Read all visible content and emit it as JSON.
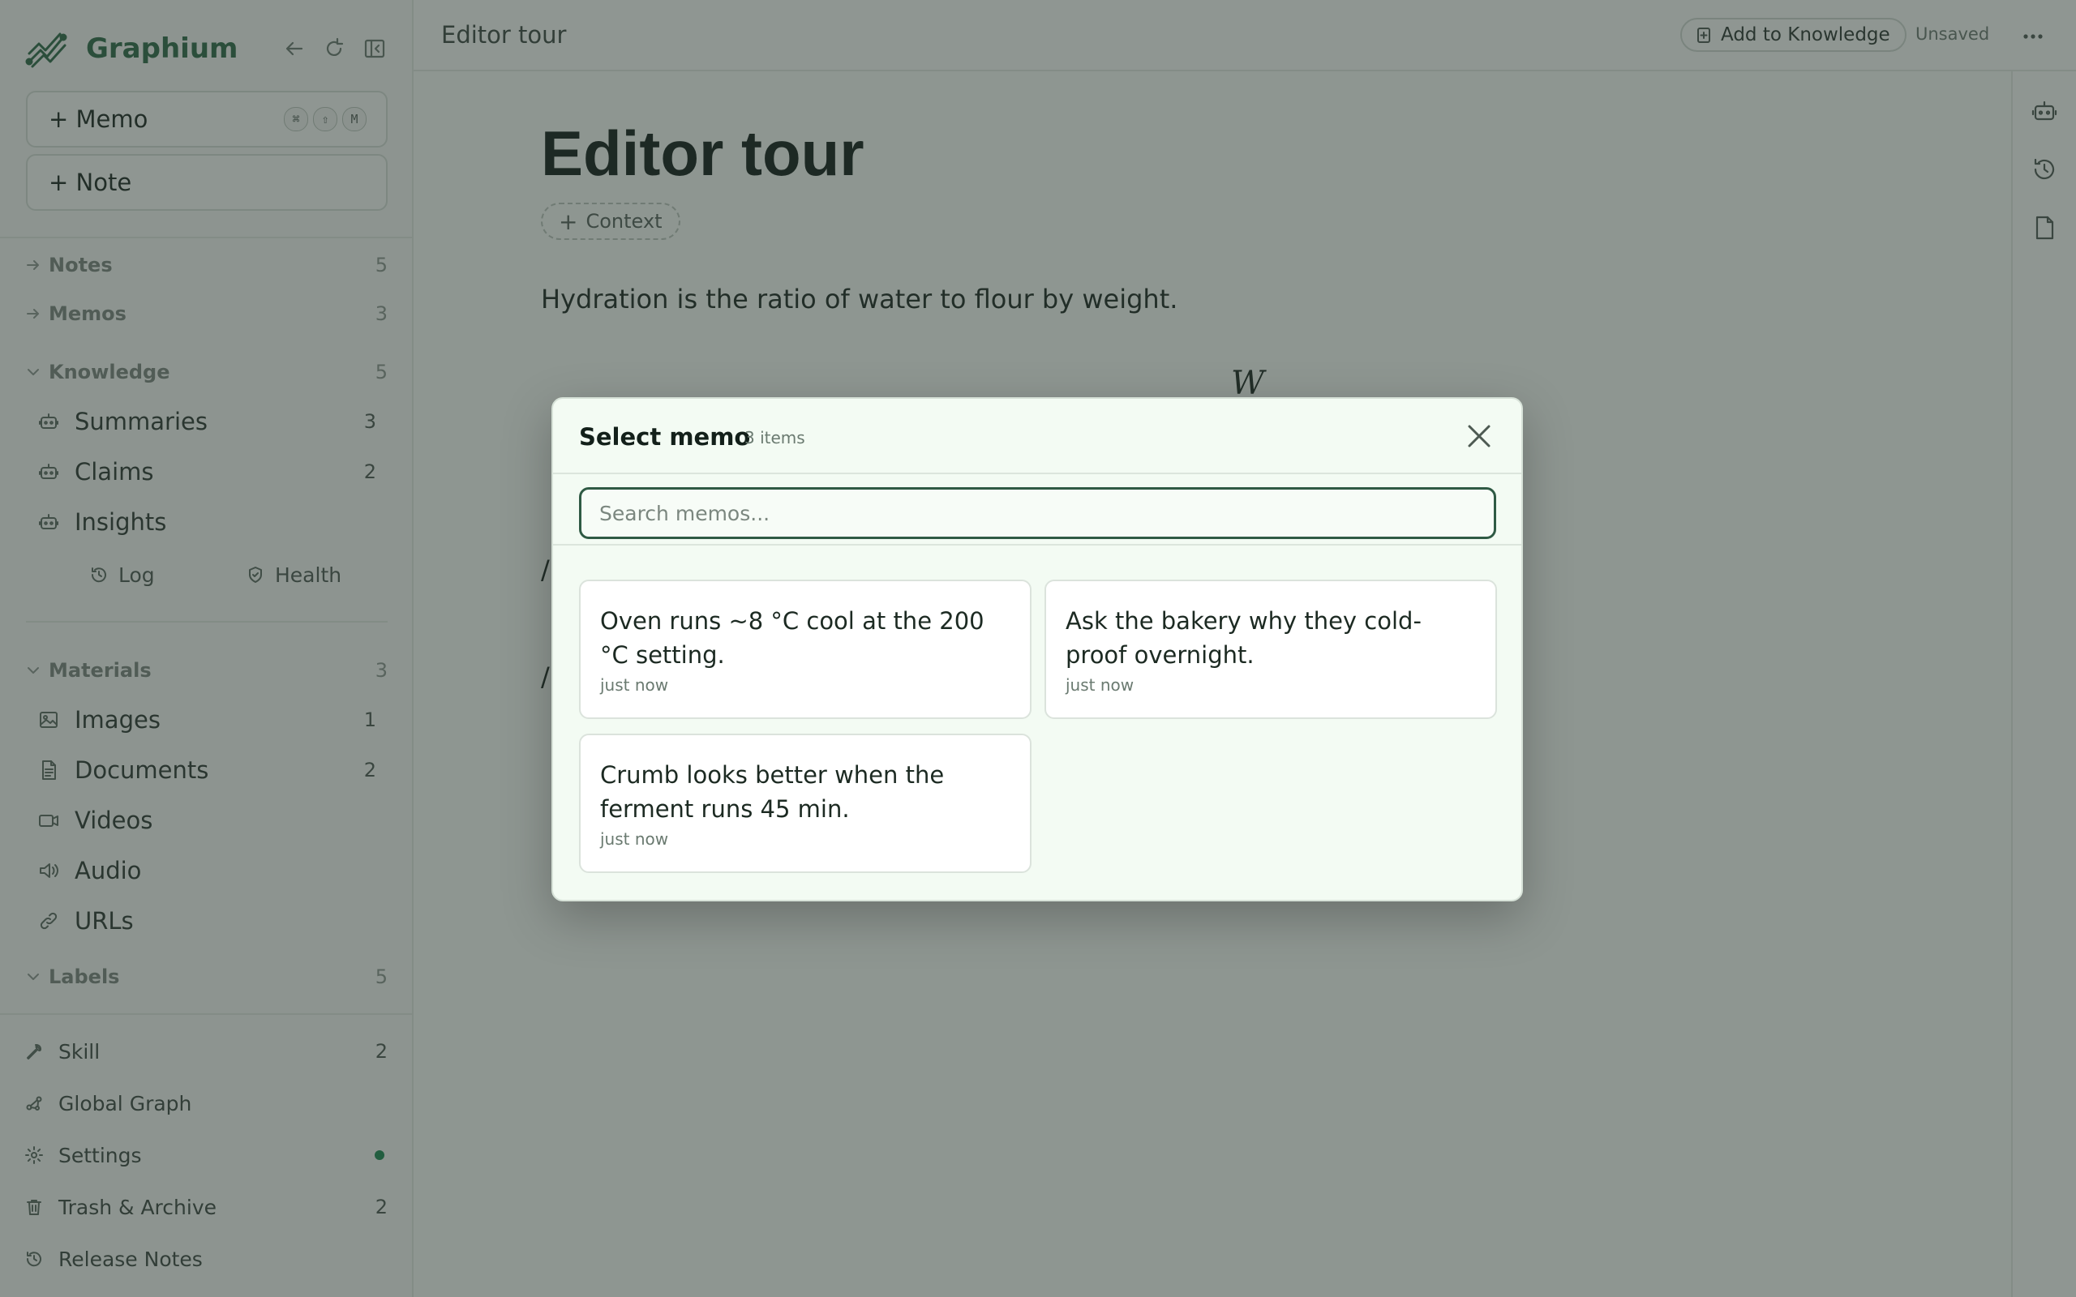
{
  "app": {
    "name": "Graphium"
  },
  "sidebar": {
    "memo_button": "+ Memo",
    "memo_shortcut": [
      "⌘",
      "⇧",
      "M"
    ],
    "note_button": "+ Note",
    "sections": {
      "notes": {
        "label": "Notes",
        "count": "5"
      },
      "memos": {
        "label": "Memos",
        "count": "3"
      },
      "knowledge": {
        "label": "Knowledge",
        "count": "5"
      },
      "materials": {
        "label": "Materials",
        "count": "3"
      },
      "labels": {
        "label": "Labels",
        "count": "5"
      }
    },
    "knowledge_items": [
      {
        "label": "Summaries",
        "count": "3",
        "icon": "robot-icon"
      },
      {
        "label": "Claims",
        "count": "2",
        "icon": "robot-icon"
      },
      {
        "label": "Insights",
        "count": "",
        "icon": "robot-icon"
      }
    ],
    "knowledge_sub": {
      "log": "Log",
      "health": "Health"
    },
    "material_items": [
      {
        "label": "Images",
        "count": "1",
        "icon": "image-icon"
      },
      {
        "label": "Documents",
        "count": "2",
        "icon": "document-icon"
      },
      {
        "label": "Videos",
        "count": "",
        "icon": "video-icon"
      },
      {
        "label": "Audio",
        "count": "",
        "icon": "audio-icon"
      },
      {
        "label": "URLs",
        "count": "",
        "icon": "link-icon"
      }
    ],
    "footer": {
      "skill": {
        "label": "Skill",
        "count": "2"
      },
      "global_graph": {
        "label": "Global Graph"
      },
      "settings": {
        "label": "Settings"
      },
      "trash": {
        "label": "Trash & Archive",
        "count": "2"
      },
      "release_notes": {
        "label": "Release Notes"
      }
    }
  },
  "topbar": {
    "breadcrumb": "Editor tour",
    "add_to_knowledge": "Add to Knowledge",
    "status": "Unsaved"
  },
  "editor": {
    "title": "Editor tour",
    "context_chip": "Context",
    "paragraph": "Hydration is the ratio of water to flour by weight.",
    "math_fragment": "W",
    "line_slash_1": "/",
    "line_slash_2": "/"
  },
  "modal": {
    "title": "Select memo",
    "count": "3 items",
    "search_placeholder": "Search memos...",
    "memos": [
      {
        "text": "Oven runs ~8 °C cool at the 200 °C setting.",
        "time": "just now"
      },
      {
        "text": "Ask the bakery why they cold-proof overnight.",
        "time": "just now"
      },
      {
        "text": "Crumb looks better when the ferment runs 45 min.",
        "time": "just now"
      }
    ]
  },
  "colors": {
    "brand": "#2f6b48",
    "accent_dot": "#1d8a52",
    "overlay": "rgba(40,50,45,0.50)"
  }
}
